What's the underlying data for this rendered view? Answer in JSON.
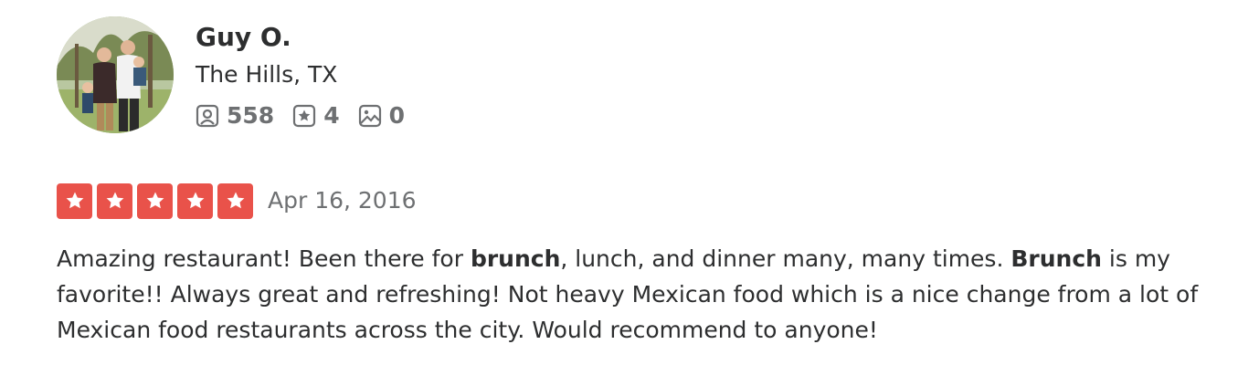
{
  "user": {
    "name": "Guy O.",
    "location": "The Hills, TX",
    "avatar_icon": "user-photo-avatar",
    "stats": {
      "friends": {
        "icon": "friends-icon",
        "value": "558"
      },
      "reviews": {
        "icon": "review-star-icon",
        "value": "4"
      },
      "photos": {
        "icon": "photo-icon",
        "value": "0"
      }
    }
  },
  "review": {
    "rating": 5,
    "rating_max": 5,
    "star_color": "#e9524a",
    "date": "Apr 16, 2016",
    "text_parts": {
      "p1": "Amazing restaurant! Been there for ",
      "b1": "brunch",
      "p2": ", lunch, and dinner many, many times. ",
      "b2": "Brunch",
      "p3": " is my favorite!! Always great and refreshing! Not heavy Mexican food which is a nice change from a lot of Mexican food restaurants across the city. Would recommend to anyone!"
    }
  }
}
